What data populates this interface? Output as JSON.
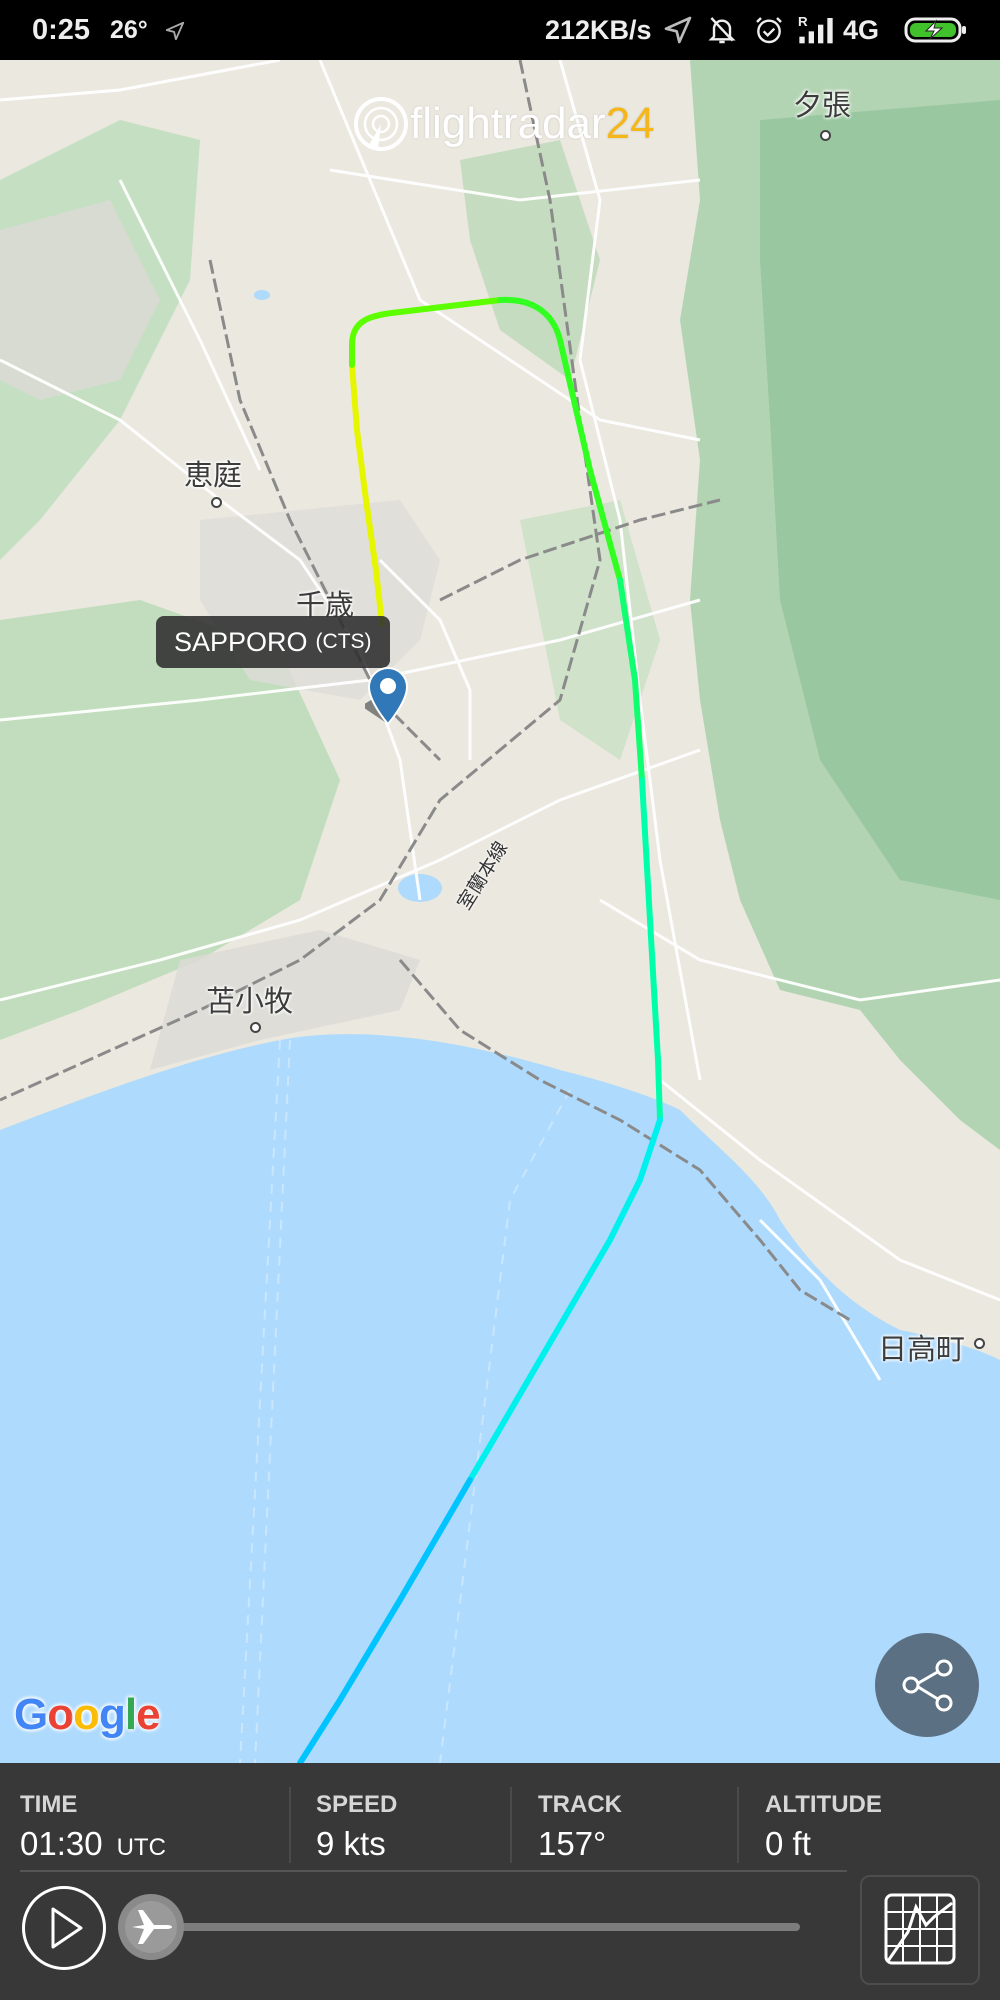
{
  "status_bar": {
    "time": "0:25",
    "temperature": "26°",
    "network_speed": "212KB/s",
    "network_type": "4G",
    "icons": [
      "location-arrow-icon",
      "bell-off-icon",
      "alarm-clock-icon",
      "signal-roaming-icon",
      "battery-charging-icon"
    ]
  },
  "map": {
    "logo": {
      "word": "flightradar",
      "number": "24"
    },
    "places": [
      {
        "name": "夕張"
      },
      {
        "name": "恵庭"
      },
      {
        "name": "千歳"
      },
      {
        "name": "苫小牧"
      },
      {
        "name": "日高町"
      }
    ],
    "rail_label": "室蘭本線",
    "airport": {
      "name": "SAPPORO",
      "code": "(CTS)"
    },
    "attribution": "Google",
    "track_colors": [
      "#ffe600",
      "#c6ff00",
      "#5dff00",
      "#22ff33",
      "#00ff88",
      "#00f5e8",
      "#00c8ff"
    ],
    "water_color": "#aedafd"
  },
  "panel": {
    "stats": [
      {
        "label": "TIME",
        "value": "01:30",
        "unit": "UTC"
      },
      {
        "label": "SPEED",
        "value": "9 kts",
        "unit": ""
      },
      {
        "label": "TRACK",
        "value": "157°",
        "unit": ""
      },
      {
        "label": "ALTITUDE",
        "value": "0 ft",
        "unit": ""
      }
    ],
    "playback_progress_percent": 0
  },
  "colors": {
    "panel_bg": "#383838",
    "share_bg": "#5c7083",
    "fr24_accent": "#f4b619",
    "pin_blue": "#3078b7"
  }
}
